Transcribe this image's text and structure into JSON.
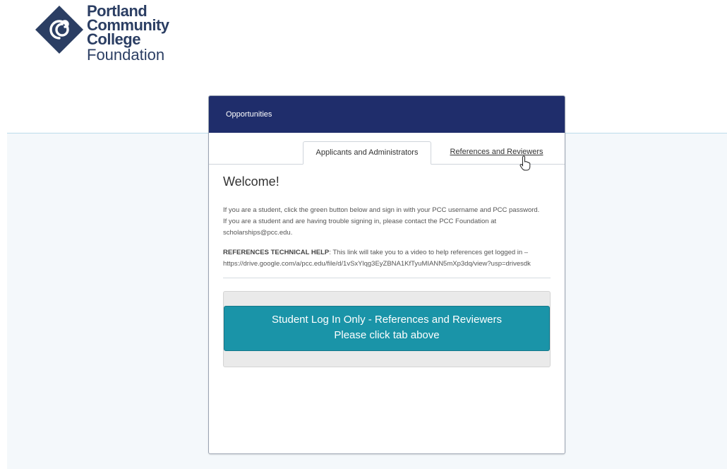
{
  "logo": {
    "line1": "Portland",
    "line2": "Community",
    "line3": "College",
    "line4": "Foundation",
    "brand_color": "#2b3e63"
  },
  "navbar": {
    "item": "Opportunities",
    "color": "#1f2d6b"
  },
  "tabs": {
    "applicants": "Applicants and Administrators",
    "references": "References and Reviewers"
  },
  "content": {
    "welcome": "Welcome!",
    "p1": "If you are a student, click the green button below and sign in with your PCC username and PCC password.",
    "p2": "If you are a student and are having trouble signing in, please contact the PCC Foundation at scholarships@pcc.edu.",
    "p3_label": "REFERENCES TECHNICAL HELP",
    "p3_text": ": This link will take you to a video to help references get logged in – https://drive.google.com/a/pcc.edu/file/d/1vSxYlqg3EyZBNA1KfTyuMIANN5mXp3dq/view?usp=drivesdk"
  },
  "login_button": {
    "line1": "Student Log In Only - References and Reviewers",
    "line2": "Please click tab above",
    "color": "#1a94a8"
  }
}
